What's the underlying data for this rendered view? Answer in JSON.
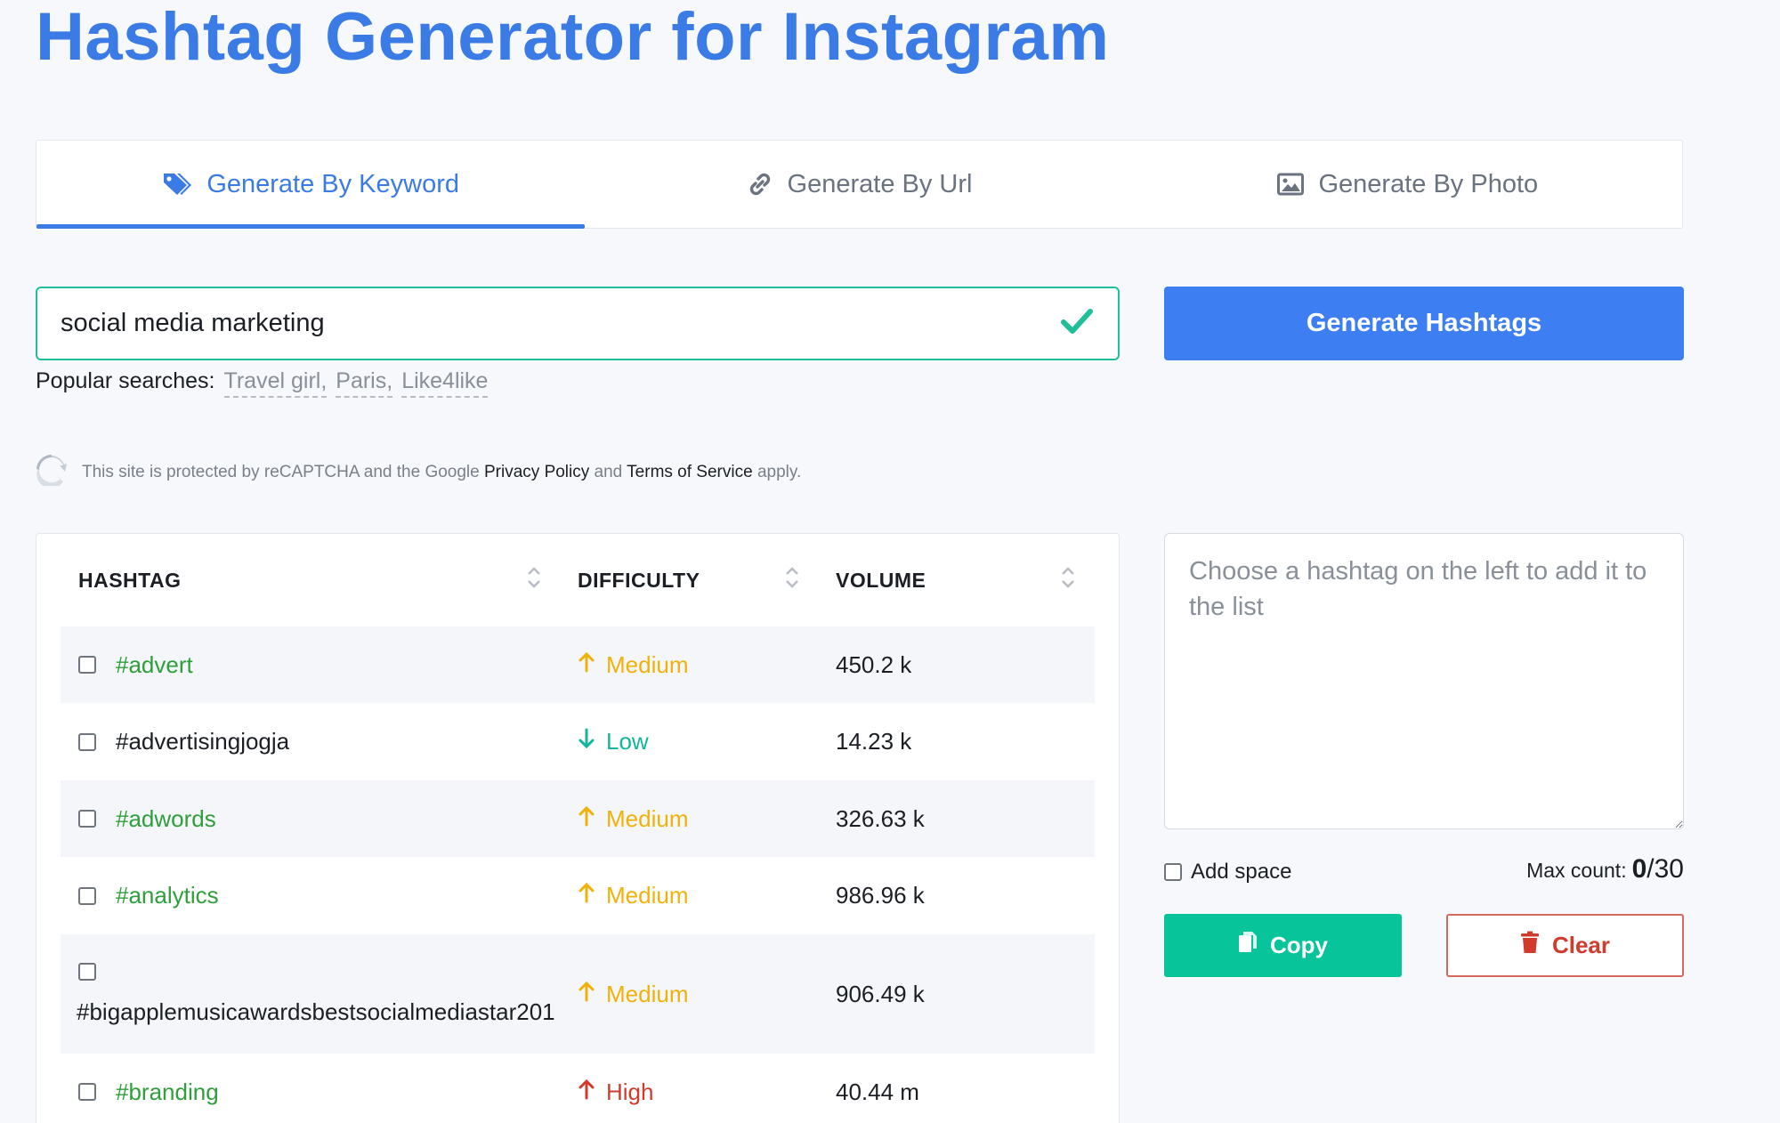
{
  "page_title": "Hashtag Generator for Instagram",
  "tabs": [
    {
      "label": "Generate By Keyword",
      "icon": "tag-icon",
      "active": true
    },
    {
      "label": "Generate By Url",
      "icon": "link-icon",
      "active": false
    },
    {
      "label": "Generate By Photo",
      "icon": "image-icon",
      "active": false
    }
  ],
  "search": {
    "value": "social media marketing"
  },
  "generate_label": "Generate Hashtags",
  "popular": {
    "label": "Popular searches:",
    "items": [
      "Travel girl,",
      "Paris,",
      "Like4like"
    ]
  },
  "recaptcha": {
    "text1": "This site is protected by reCAPTCHA and the Google",
    "privacy": "Privacy Policy",
    "and": "and",
    "terms": "Terms of Service",
    "apply": "apply."
  },
  "table": {
    "headers": {
      "hashtag": "HASHTAG",
      "difficulty": "DIFFICULTY",
      "volume": "VOLUME"
    },
    "rows": [
      {
        "tag": "#advert",
        "difficulty": "Medium",
        "volume": "450.2 k"
      },
      {
        "tag": "#advertisingjogja",
        "difficulty": "Low",
        "volume": "14.23 k"
      },
      {
        "tag": "#adwords",
        "difficulty": "Medium",
        "volume": "326.63 k"
      },
      {
        "tag": "#analytics",
        "difficulty": "Medium",
        "volume": "986.96 k"
      },
      {
        "tag": "#bigapplemusicawardsbestsocialmediastar201",
        "difficulty": "Medium",
        "volume": "906.49 k"
      },
      {
        "tag": "#branding",
        "difficulty": "High",
        "volume": "40.44 m"
      }
    ]
  },
  "panel": {
    "placeholder": "Choose a hashtag on the left to add it to the list",
    "add_space": "Add space",
    "max_label": "Max count:",
    "count_current": "0",
    "count_max": "/30",
    "copy_label": "Copy",
    "clear_label": "Clear"
  },
  "colors": {
    "accent": "#3b7be6",
    "success": "#08c49b",
    "danger": "#d13b2d",
    "medium": "#f0b20a",
    "low": "#13b5a0",
    "tag_green": "#2e9f3a"
  }
}
